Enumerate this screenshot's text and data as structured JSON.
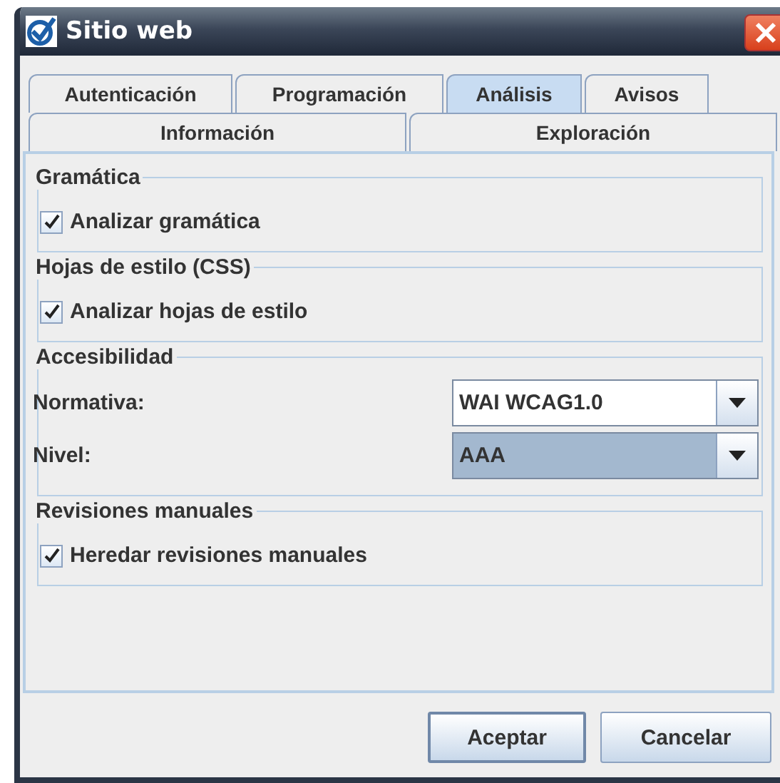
{
  "window": {
    "title": "Sitio web"
  },
  "tab_rows": [
    [
      {
        "label": "Autenticación",
        "selected": false
      },
      {
        "label": "Programación",
        "selected": false
      },
      {
        "label": "Análisis",
        "selected": true
      },
      {
        "label": "Avisos",
        "selected": false
      }
    ],
    [
      {
        "label": "Información",
        "selected": false
      },
      {
        "label": "Exploración",
        "selected": false
      }
    ]
  ],
  "groups": [
    {
      "title": "Gramática",
      "items": [
        {
          "kind": "checkbox",
          "label": "Analizar gramática",
          "checked": true
        }
      ]
    },
    {
      "title": "Hojas de estilo (CSS)",
      "items": [
        {
          "kind": "checkbox",
          "label": "Analizar hojas de estilo",
          "checked": true
        }
      ]
    },
    {
      "title": "Accesibilidad",
      "items": [
        {
          "kind": "combo",
          "label": "Normativa:",
          "value": "WAI WCAG1.0",
          "focused": false
        },
        {
          "kind": "combo",
          "label": "Nivel:",
          "value": "AAA",
          "focused": true
        }
      ]
    },
    {
      "title": "Revisiones manuales",
      "items": [
        {
          "kind": "checkbox",
          "label": "Heredar revisiones manuales",
          "checked": true
        }
      ]
    }
  ],
  "buttons": [
    {
      "label": "Aceptar",
      "default": true
    },
    {
      "label": "Cancelar",
      "default": false
    }
  ]
}
